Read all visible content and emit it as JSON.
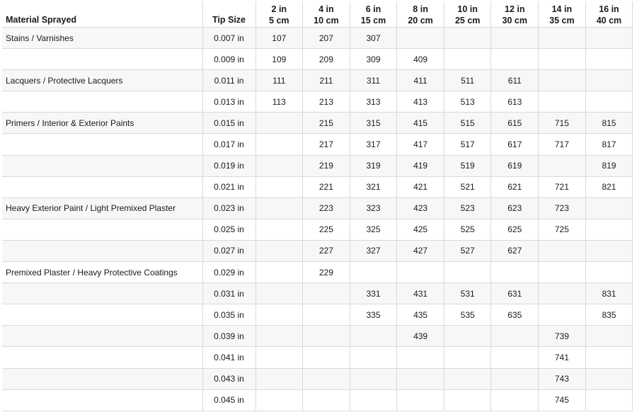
{
  "headers": {
    "material": "Material Sprayed",
    "tip_size": "Tip Size",
    "distances": [
      {
        "in": "2 in",
        "cm": "5 cm"
      },
      {
        "in": "4 in",
        "cm": "10 cm"
      },
      {
        "in": "6 in",
        "cm": "15 cm"
      },
      {
        "in": "8 in",
        "cm": "20 cm"
      },
      {
        "in": "10 in",
        "cm": "25 cm"
      },
      {
        "in": "12 in",
        "cm": "30 cm"
      },
      {
        "in": "14 in",
        "cm": "35 cm"
      },
      {
        "in": "16 in",
        "cm": "40 cm"
      }
    ]
  },
  "rows": [
    {
      "material": "Stains / Varnishes",
      "tip": "0.007 in",
      "codes": [
        "107",
        "207",
        "307",
        "",
        "",
        "",
        "",
        ""
      ]
    },
    {
      "material": "",
      "tip": "0.009 in",
      "codes": [
        "109",
        "209",
        "309",
        "409",
        "",
        "",
        "",
        ""
      ]
    },
    {
      "material": "Lacquers / Protective Lacquers",
      "tip": "0.011 in",
      "codes": [
        "111",
        "211",
        "311",
        "411",
        "511",
        "611",
        "",
        ""
      ]
    },
    {
      "material": "",
      "tip": "0.013 in",
      "codes": [
        "113",
        "213",
        "313",
        "413",
        "513",
        "613",
        "",
        ""
      ]
    },
    {
      "material": "Primers / Interior & Exterior Paints",
      "tip": "0.015 in",
      "codes": [
        "",
        "215",
        "315",
        "415",
        "515",
        "615",
        "715",
        "815"
      ]
    },
    {
      "material": "",
      "tip": "0.017 in",
      "codes": [
        "",
        "217",
        "317",
        "417",
        "517",
        "617",
        "717",
        "817"
      ]
    },
    {
      "material": "",
      "tip": "0.019 in",
      "codes": [
        "",
        "219",
        "319",
        "419",
        "519",
        "619",
        "",
        "819"
      ]
    },
    {
      "material": "",
      "tip": "0.021 in",
      "codes": [
        "",
        "221",
        "321",
        "421",
        "521",
        "621",
        "721",
        "821"
      ]
    },
    {
      "material": "Heavy Exterior Paint / Light Premixed Plaster",
      "tip": "0.023 in",
      "codes": [
        "",
        "223",
        "323",
        "423",
        "523",
        "623",
        "723",
        ""
      ]
    },
    {
      "material": "",
      "tip": "0.025 in",
      "codes": [
        "",
        "225",
        "325",
        "425",
        "525",
        "625",
        "725",
        ""
      ]
    },
    {
      "material": "",
      "tip": "0.027 in",
      "codes": [
        "",
        "227",
        "327",
        "427",
        "527",
        "627",
        "",
        ""
      ]
    },
    {
      "material": "Premixed Plaster / Heavy Protective Coatings",
      "tip": "0.029 in",
      "codes": [
        "",
        "229",
        "",
        "",
        "",
        "",
        "",
        ""
      ]
    },
    {
      "material": "",
      "tip": "0.031 in",
      "codes": [
        "",
        "",
        "331",
        "431",
        "531",
        "631",
        "",
        "831"
      ]
    },
    {
      "material": "",
      "tip": "0.035 in",
      "codes": [
        "",
        "",
        "335",
        "435",
        "535",
        "635",
        "",
        "835"
      ]
    },
    {
      "material": "",
      "tip": "0.039 in",
      "codes": [
        "",
        "",
        "",
        "439",
        "",
        "",
        "739",
        ""
      ]
    },
    {
      "material": "",
      "tip": "0.041 in",
      "codes": [
        "",
        "",
        "",
        "",
        "",
        "",
        "741",
        ""
      ]
    },
    {
      "material": "",
      "tip": "0.043 in",
      "codes": [
        "",
        "",
        "",
        "",
        "",
        "",
        "743",
        ""
      ]
    },
    {
      "material": "",
      "tip": "0.045 in",
      "codes": [
        "",
        "",
        "",
        "",
        "",
        "",
        "745",
        ""
      ]
    }
  ]
}
